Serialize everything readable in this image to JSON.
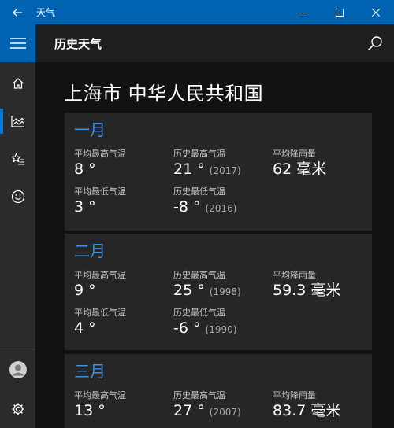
{
  "window": {
    "title": "天气"
  },
  "header": {
    "title": "历史天气"
  },
  "city": "上海市 中华人民共和国",
  "months": [
    {
      "name": "一月",
      "avg_high_label": "平均最高气温",
      "avg_high": "8 °",
      "rec_high_label": "历史最高气温",
      "rec_high": "21 °",
      "rec_high_year": "(2017)",
      "rain_label": "平均降雨量",
      "rain": "62 毫米",
      "avg_low_label": "平均最低气温",
      "avg_low": "3 °",
      "rec_low_label": "历史最低气温",
      "rec_low": "-8 °",
      "rec_low_year": "(2016)"
    },
    {
      "name": "二月",
      "avg_high_label": "平均最高气温",
      "avg_high": "9 °",
      "rec_high_label": "历史最高气温",
      "rec_high": "25 °",
      "rec_high_year": "(1998)",
      "rain_label": "平均降雨量",
      "rain": "59.3 毫米",
      "avg_low_label": "平均最低气温",
      "avg_low": "4 °",
      "rec_low_label": "历史最低气温",
      "rec_low": "-6 °",
      "rec_low_year": "(1990)"
    },
    {
      "name": "三月",
      "avg_high_label": "平均最高气温",
      "avg_high": "13 °",
      "rec_high_label": "历史最高气温",
      "rec_high": "27 °",
      "rec_high_year": "(2007)",
      "rain_label": "平均降雨量",
      "rain": "83.7 毫米"
    }
  ],
  "icons": {
    "back": "back-arrow-icon",
    "minimize": "minimize-icon",
    "maximize": "maximize-icon",
    "close": "close-icon",
    "menu": "hamburger-icon",
    "home": "home-icon",
    "history": "historical-weather-icon",
    "favorites": "favorites-icon",
    "feedback": "smiley-icon",
    "account": "account-icon",
    "settings": "gear-icon",
    "search": "search-icon"
  },
  "colors": {
    "accent": "#0063b1",
    "month": "#3d8fe0",
    "card": "#262626"
  }
}
